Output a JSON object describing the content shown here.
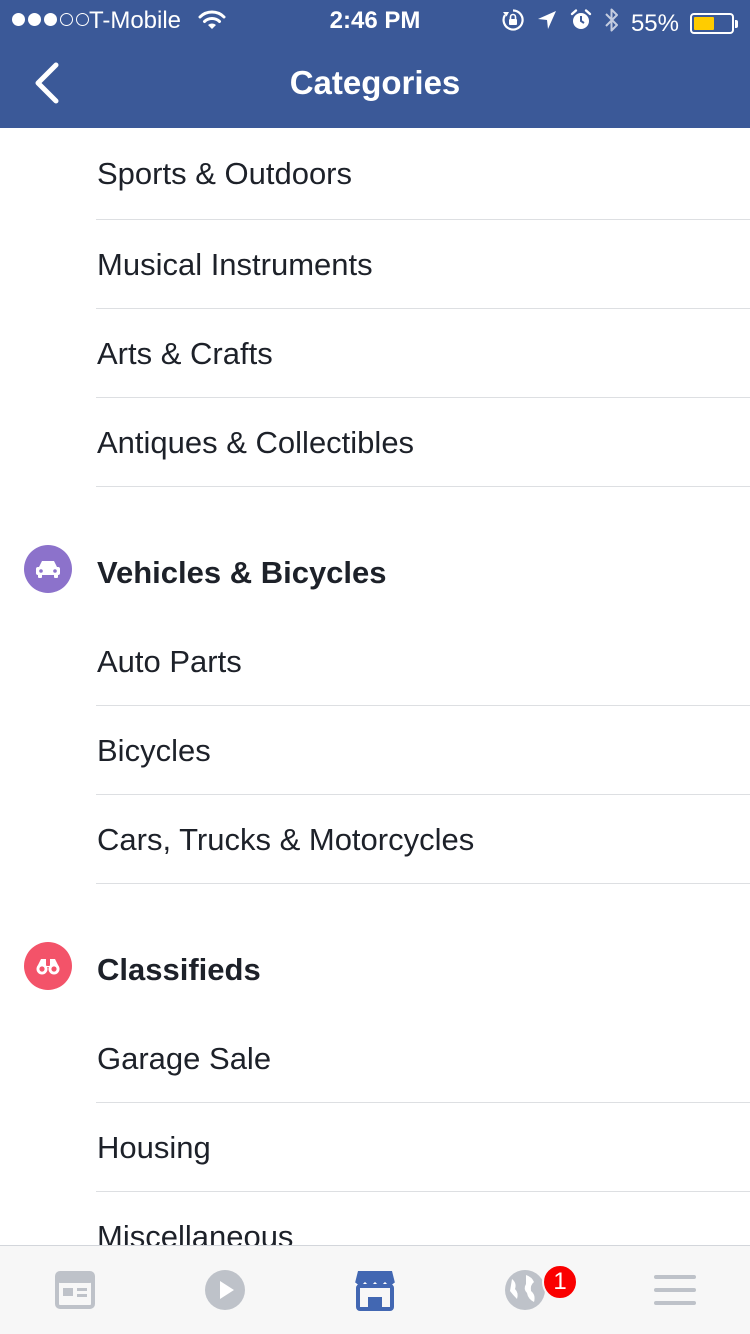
{
  "status_bar": {
    "carrier": "T-Mobile",
    "time": "2:46 PM",
    "battery": "55%",
    "battery_level": 0.55,
    "signal_bars_filled": 3,
    "signal_bars_total": 5
  },
  "nav": {
    "title": "Categories",
    "back_icon": "chevron-left-icon"
  },
  "list": {
    "top_items": [
      {
        "label": "Sports & Outdoors"
      },
      {
        "label": "Musical Instruments"
      },
      {
        "label": "Arts & Crafts"
      },
      {
        "label": "Antiques & Collectibles"
      }
    ],
    "sections": [
      {
        "title": "Vehicles & Bicycles",
        "icon": "car-icon",
        "icon_color": "#8c72cb",
        "items": [
          {
            "label": "Auto Parts"
          },
          {
            "label": "Bicycles"
          },
          {
            "label": "Cars, Trucks & Motorcycles"
          }
        ]
      },
      {
        "title": "Classifieds",
        "icon": "binoculars-icon",
        "icon_color": "#f35369",
        "items": [
          {
            "label": "Garage Sale"
          },
          {
            "label": "Housing"
          },
          {
            "label": "Miscellaneous"
          }
        ]
      }
    ]
  },
  "tab_bar": {
    "tabs": [
      {
        "icon": "news-feed-icon",
        "active": false
      },
      {
        "icon": "video-play-icon",
        "active": false
      },
      {
        "icon": "marketplace-store-icon",
        "active": true
      },
      {
        "icon": "notifications-globe-icon",
        "active": false
      },
      {
        "icon": "menu-icon",
        "active": false
      }
    ],
    "notification_badge": "1"
  },
  "colors": {
    "brand_blue": "#3b5998",
    "active_tab": "#4267b2",
    "inactive_tab": "#bec2c9",
    "badge_red": "#fa0000",
    "battery_yellow": "#ffcc00"
  }
}
